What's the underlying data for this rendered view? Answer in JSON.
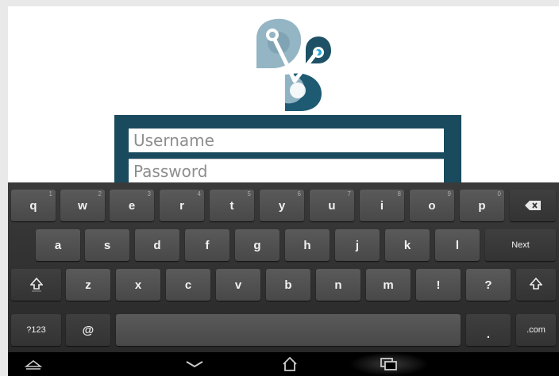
{
  "login": {
    "username_placeholder": "Username",
    "password_placeholder": "Password"
  },
  "keyboard": {
    "row1": [
      {
        "label": "q",
        "hint": "1"
      },
      {
        "label": "w",
        "hint": "2"
      },
      {
        "label": "e",
        "hint": "3"
      },
      {
        "label": "r",
        "hint": "4"
      },
      {
        "label": "t",
        "hint": "5"
      },
      {
        "label": "y",
        "hint": "6"
      },
      {
        "label": "u",
        "hint": "7"
      },
      {
        "label": "i",
        "hint": "8"
      },
      {
        "label": "o",
        "hint": "9"
      },
      {
        "label": "p",
        "hint": "0"
      }
    ],
    "row2": [
      "a",
      "s",
      "d",
      "f",
      "g",
      "h",
      "j",
      "k",
      "l"
    ],
    "row3": [
      "z",
      "x",
      "c",
      "v",
      "b",
      "n",
      "m",
      "!",
      "?"
    ],
    "next_label": "Next",
    "symbols_label": "?123",
    "at_label": "@",
    "period_label": ".",
    "dotcom_label": ".com",
    "icons": {
      "backspace": "backspace-icon",
      "shift": "shift-icon"
    }
  },
  "navbar": {
    "icons": [
      "keyboard-hide-icon",
      "back-chevron-icon",
      "home-icon",
      "recent-apps-icon"
    ]
  },
  "colors": {
    "logo_dark": "#1e5a72",
    "logo_light": "#8fb3c3",
    "accent": "#2aa6d6",
    "login_box": "#1a4a5e"
  }
}
